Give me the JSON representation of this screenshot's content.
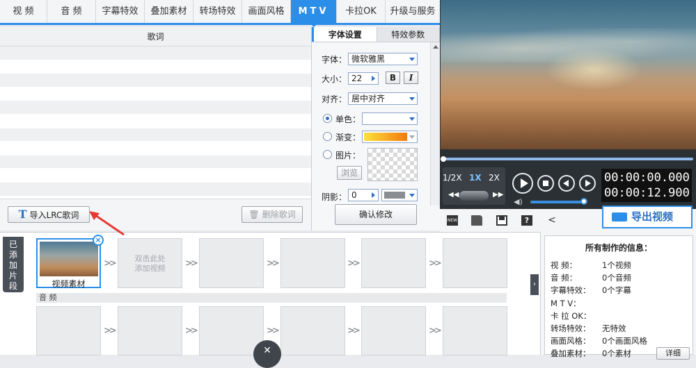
{
  "tabs": [
    {
      "label": "视 频"
    },
    {
      "label": "音 频"
    },
    {
      "label": "字幕特效"
    },
    {
      "label": "叠加素材"
    },
    {
      "label": "转场特效"
    },
    {
      "label": "画面风格"
    },
    {
      "label": "MTV"
    },
    {
      "label": "卡拉OK"
    },
    {
      "label": "升级与服务"
    }
  ],
  "lyrics": {
    "header": "歌词",
    "import_label": "导入LRC歌词",
    "delete_label": "删除歌词"
  },
  "font_panel": {
    "tab_font": "字体设置",
    "tab_effect": "特效参数",
    "font_label": "字体：",
    "font_value": "微软雅黑",
    "size_label": "大小：",
    "size_value": "22",
    "bold": "B",
    "italic": "I",
    "align_label": "对齐：",
    "align_value": "居中对齐",
    "mono_label": "单色：",
    "gradient_label": "渐变：",
    "image_label": "图片：",
    "browse_label": "浏览",
    "shadow_label": "阴影：",
    "shadow_value": "0",
    "confirm_label": "确认修改",
    "gradient_from": "#fde23b",
    "gradient_to": "#f27a10"
  },
  "player": {
    "speeds": [
      "1/2X",
      "1X",
      "2X"
    ],
    "time_current": "00:00:00.000",
    "time_total": "00:00:12.900",
    "export_label": "导出视频"
  },
  "timeline": {
    "added_label": "已添加片段",
    "clip_label": "视频素材",
    "add_hint_line1": "双击此处",
    "add_hint_line2": "添加视频",
    "audio_label": "音 频"
  },
  "info": {
    "title": "所有制作的信息：",
    "rows": [
      {
        "key": "视    频：",
        "value": "1个视频"
      },
      {
        "key": "音    频：",
        "value": "0个音频"
      },
      {
        "key": "字幕特效：",
        "value": "0个字幕"
      },
      {
        "key": "M    T    V：",
        "value": ""
      },
      {
        "key": "卡 拉 OK：",
        "value": ""
      },
      {
        "key": "转场特效：",
        "value": "无特效"
      },
      {
        "key": "画面风格：",
        "value": "0个画面风格"
      },
      {
        "key": "叠加素材：",
        "value": "0个素材"
      }
    ],
    "detail_label": "详细"
  },
  "colors": {
    "accent": "#2b8ee8",
    "annotation_arrow": "#e53935"
  },
  "icons": {
    "new": "new-icon",
    "open": "folder-icon",
    "save": "save-icon",
    "help": "help-icon",
    "share": "share-icon"
  }
}
